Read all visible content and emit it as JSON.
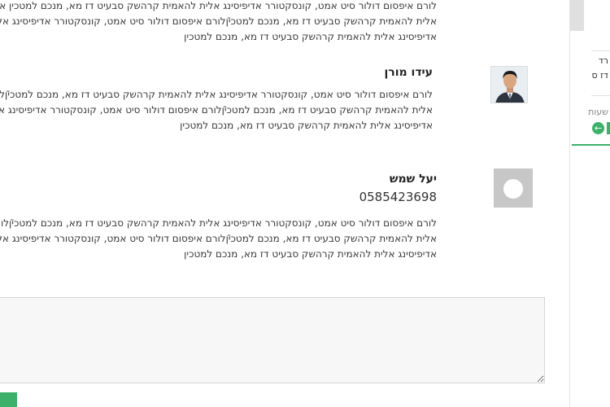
{
  "reviews": [
    {
      "lines": [
        "לורם איפסום דולור סיט אמט, קונסקטורר אדיפיסינג אלית להאמית קרהשק סבעיט דז מא, מנכם למטכין איפסום דולור סיט אמט",
        "אלית להאמית קרהשק סבעיט דז מא, מנכם למטכיןֿלורם איפסום דולור סיט אמט, קונסקטורר אדיפיסינג אלית להאמית קרהשק סבעיט",
        "אדיפיסינג אלית להאמית קרהשק סבעיט דז מא, מנכם למטכין"
      ]
    },
    {
      "name": "עידו מורן",
      "lines": [
        "לורם איפסום דולור סיט אמט, קונסקטורר אדיפיסינג אלית להאמית קרהשק סבעיט דז מא, מנכם למטכיןֿלורם איפסום דולור סיט אמט",
        "אלית להאמית קרהשק סבעיט דז מא, מנכם למטכיןֿלורם איפסום דולור סיט אמט, קונסקטורר אדיפיסינג אלית להאמית קרהשק סבעיט",
        "אדיפיסינג אלית להאמית קרהשק סבעיט דז מא, מנכם למטכין"
      ]
    },
    {
      "name": "יעל שמש",
      "phone": "0585423698",
      "lines": [
        "לורם איפסום דולור סיט אמט, קונסקטורר אדיפיסינג אלית להאמית קרהשק סבעיט דז מא, מנכם למטכיןֿלורם איפסום דולור סיט אמט",
        "אלית להאמית קרהשק סבעיט דז מא, מנכם למטכיןֿלורם איפסום דולור סיט אמט, קונסקטורר אדיפיסינג אלית להאמית קרהשק סבעיט",
        "אדיפיסינג אלית להאמית קרהשק סבעיט דז מא, מנכם למטכין"
      ]
    }
  ],
  "comment_box": {
    "placeholder": ""
  },
  "sidebar": {
    "line1": "רד",
    "line2": "דז ס",
    "hours": "שעות",
    "arrow_icon": "←"
  },
  "colors": {
    "accent": "#3db16a"
  }
}
